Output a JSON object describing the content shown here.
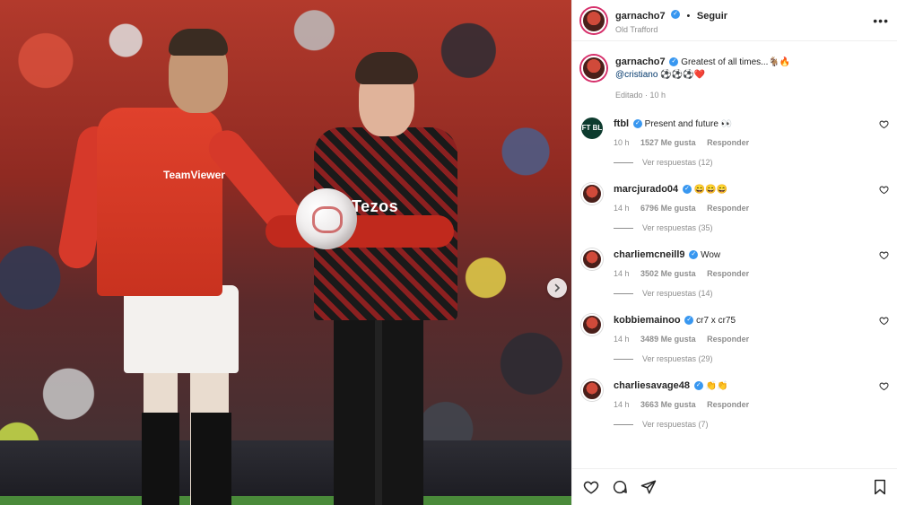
{
  "post": {
    "author": "garnacho7",
    "follow_label": "Seguir",
    "location": "Old Trafford",
    "caption_text": "Greatest of all times...🐐🔥",
    "caption_mention": "@cristiano",
    "caption_emojis": "⚽⚽⚽❤️",
    "edited_meta": "Editado · 10 h"
  },
  "photo": {
    "sponsor_left": "TeamViewer",
    "sponsor_right": "Tezos"
  },
  "comments": [
    {
      "user": "ftbl",
      "avatar_text": "FT BL",
      "text": "Present and future 👀",
      "time": "10 h",
      "likes": "1527 Me gusta",
      "reply": "Responder",
      "replies": "Ver respuestas (12)"
    },
    {
      "user": "marcjurado04",
      "avatar_text": "",
      "text": "😄😄😄",
      "time": "14 h",
      "likes": "6796 Me gusta",
      "reply": "Responder",
      "replies": "Ver respuestas (35)"
    },
    {
      "user": "charliemcneill9",
      "avatar_text": "",
      "text": "Wow",
      "time": "14 h",
      "likes": "3502 Me gusta",
      "reply": "Responder",
      "replies": "Ver respuestas (14)"
    },
    {
      "user": "kobbiemainoo",
      "avatar_text": "",
      "text": "cr7 x cr75",
      "time": "14 h",
      "likes": "3489 Me gusta",
      "reply": "Responder",
      "replies": "Ver respuestas (29)"
    },
    {
      "user": "charliesavage48",
      "avatar_text": "",
      "text": "👏👏",
      "time": "14 h",
      "likes": "3663 Me gusta",
      "reply": "Responder",
      "replies": "Ver respuestas (7)"
    }
  ],
  "icons": {
    "more": "more-options-icon",
    "like": "heart-icon",
    "comment": "comment-icon",
    "share": "send-icon",
    "save": "bookmark-icon",
    "next": "chevron-right-icon"
  },
  "colors": {
    "verified": "#3897f0",
    "muted": "#8e8e8e",
    "mention": "#00376b"
  }
}
